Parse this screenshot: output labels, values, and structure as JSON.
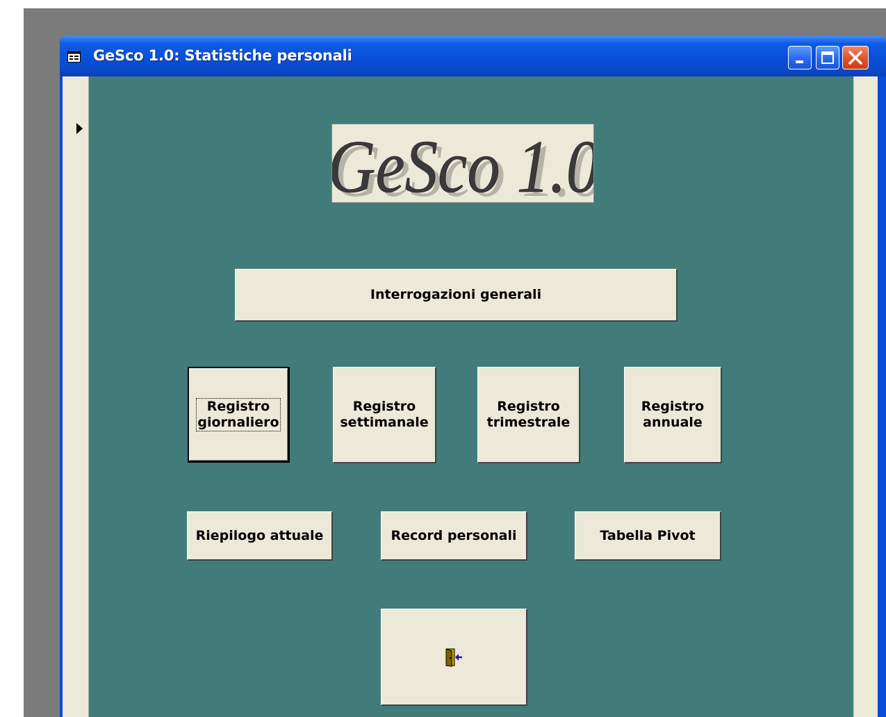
{
  "window": {
    "title": "GeSco 1.0: Statistiche personali",
    "app_icon": "form-icon",
    "controls": {
      "minimize_icon": "minimize-icon",
      "maximize_icon": "maximize-icon",
      "close_icon": "close-icon"
    }
  },
  "record_selector": {
    "icon": "current-record-arrow-icon"
  },
  "logo": {
    "text": "GeSco 1.0"
  },
  "buttons": {
    "general_queries": "Interrogazioni generali",
    "daily_line1": "Registro",
    "daily_line2": "giornaliero",
    "weekly_line1": "Registro",
    "weekly_line2": "settimanale",
    "quarterly_line1": "Registro",
    "quarterly_line2": "trimestrale",
    "yearly_line1": "Registro",
    "yearly_line2": "annuale",
    "current_summary": "Riepilogo attuale",
    "personal_records": "Record personali",
    "pivot_table": "Tabella Pivot",
    "exit_icon": "exit-door-icon"
  },
  "colors": {
    "titlebar": "#0a4fd8",
    "form_background": "#417c7b",
    "button_face": "#ece9d8",
    "close_button": "#e2542c",
    "desktop": "#7b7b7b"
  }
}
